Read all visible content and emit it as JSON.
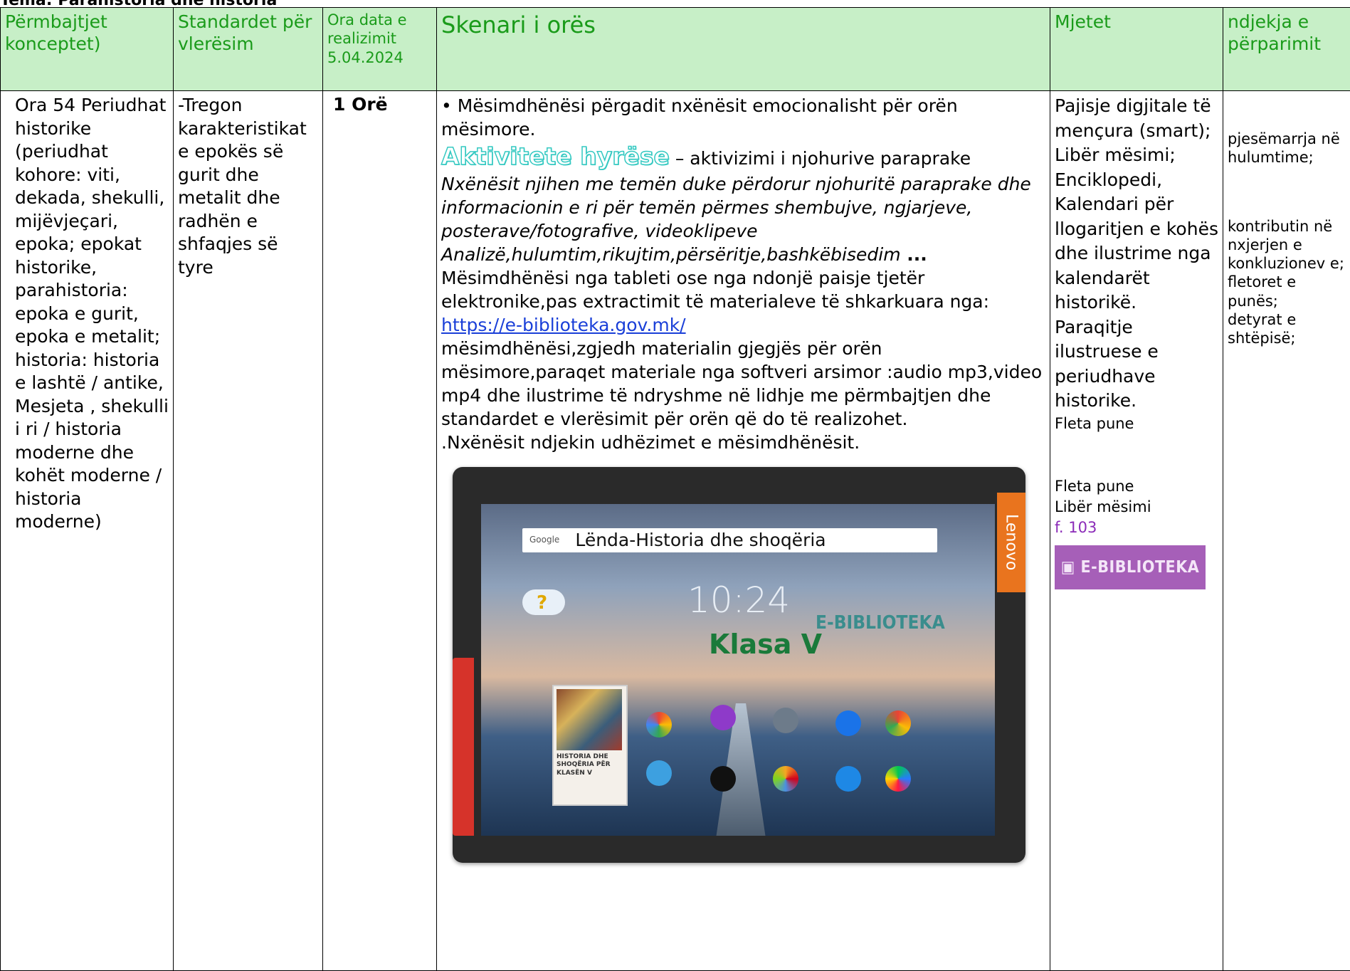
{
  "doc_title": "Tema: Parahistoria dhe historia",
  "header": {
    "col1": "Përmbajtjet konceptet)",
    "col2": "Standardet për vlerësim",
    "col3": "Ora data e realizimit 5.04.2024",
    "col4": "Skenari i orës",
    "col5": "Mjetet",
    "col6": "ndjekja e përparimit"
  },
  "row": {
    "content_concepts": "Ora 54 Periudhat historike (periudhat kohore: viti, dekada, shekulli, mijëvjeçari, epoka; epokat historike, parahistoria: epoka e gurit, epoka e metalit; historia: historia e lashtë / antike, Mesjeta , shekulli i ri / historia moderne dhe kohët moderne / historia moderne)",
    "standards": "-Tregon karakteristikat e epokës së gurit dhe metalit dhe radhën e shfaqjes së tyre",
    "hours": "1 Orë",
    "scenario": {
      "p1": "• Mësimdhënësi përgadit nxënësit emocionalisht për orën mësimore.",
      "intro_title": "Aktivitete hyrëse",
      "intro_rest": " – aktivizimi i njohurive paraprake",
      "italic1": "Nxënësit njihen me temën duke përdorur njohuritë paraprake dhe informacionin e ri për temën përmes shembujve, ngjarjeve, posterave/fotografive, videoklipeve",
      "italic2": "Analizë,hulumtim,rikujtim,përsëritje,bashkëbisedim",
      "italic2_tail": " ...",
      "p2": "Mësimdhënësi nga tableti ose nga ndonjë paisje tjetër elektronike,pas extractimit të materialeve të shkarkuara nga:",
      "link": "https://e-biblioteka.gov.mk/",
      "p3": " mësimdhënësi,zgjedh materialin gjegjës për orën mësimore,paraqet materiale nga softveri arsimor :audio mp3,video mp4 dhe ilustrime të ndryshme në lidhje me përmbajtjen dhe standardet e vlerësimit për orën që do të realizohet.",
      "p4": ".Nxënësit ndjekin udhëzimet e mësimdhënësit."
    },
    "tablet": {
      "search_brand": "Google",
      "search_text": "Lënda-Historia dhe shoqëria",
      "clock": "10:24",
      "class_label": "Klasa V",
      "library_label": "E-BIBLIOTEKA",
      "book_title": "HISTORIA DHE SHOQËRIA PËR KLASËN V",
      "brand": "Lenovo"
    },
    "tools": {
      "main": "Pajisje digjitale të mençura (smart); Libër mësimi; Enciklopedi, Kalendari për llogaritjen e kohës dhe ilustrime nga kalendarët historikë. Paraqitje ilustruese e periudhave historike.",
      "small1": "Fleta pune",
      "small2": "Fleta pune",
      "small3": "Libër mësimi",
      "page_ref": "f. 103",
      "badge": "E-BIBLIOTEKA"
    },
    "progress": {
      "a": "pjesëmarrja në hulumtime;",
      "b": "kontributin në nxjerjen e konkluzionev e;",
      "c": "fletoret e punës;",
      "d": "detyrat e shtëpisë;"
    }
  }
}
